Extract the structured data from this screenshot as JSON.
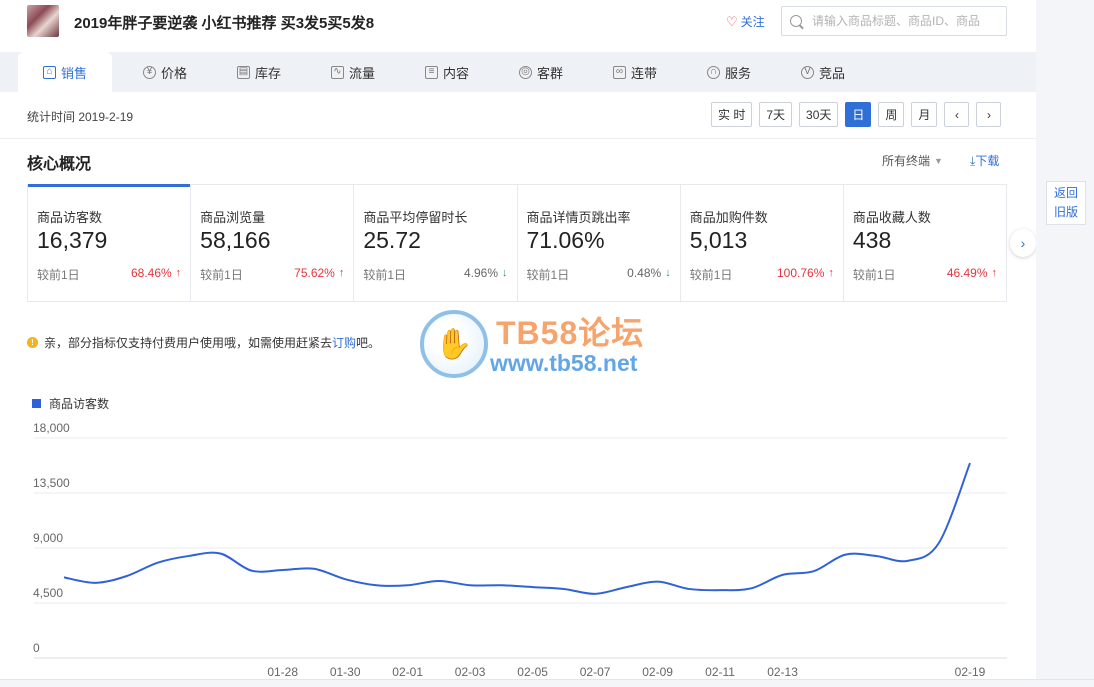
{
  "header": {
    "product_title": "2019年胖子要逆袭 小红书推荐 买3发5买5发8",
    "follow_label": "关注",
    "search_placeholder": "请输入商品标题、商品ID、商品"
  },
  "tabs": [
    {
      "label": "销售",
      "icon": "bag-icon",
      "active": true
    },
    {
      "label": "价格",
      "icon": "yen-icon"
    },
    {
      "label": "库存",
      "icon": "warehouse-icon"
    },
    {
      "label": "流量",
      "icon": "line-chart-icon"
    },
    {
      "label": "内容",
      "icon": "document-icon"
    },
    {
      "label": "客群",
      "icon": "people-icon"
    },
    {
      "label": "连带",
      "icon": "link-icon"
    },
    {
      "label": "服务",
      "icon": "headset-icon"
    },
    {
      "label": "竞品",
      "icon": "vs-icon"
    }
  ],
  "datebar": {
    "stat_time": "统计时间 2019-2-19",
    "ranges": [
      "实 时",
      "7天",
      "30天",
      "日",
      "周",
      "月"
    ],
    "active_range": "日",
    "prev": "‹",
    "next": "›"
  },
  "section": {
    "title": "核心概况",
    "terminal_label": "所有终端",
    "download_label": "下载"
  },
  "metrics": [
    {
      "name": "商品访客数",
      "value": "16,379",
      "compare": "较前1日",
      "pct": "68.46%",
      "dir": "up"
    },
    {
      "name": "商品浏览量",
      "value": "58,166",
      "compare": "较前1日",
      "pct": "75.62%",
      "dir": "up"
    },
    {
      "name": "商品平均停留时长",
      "value": "25.72",
      "compare": "较前1日",
      "pct": "4.96%",
      "dir": "down"
    },
    {
      "name": "商品详情页跳出率",
      "value": "71.06%",
      "compare": "较前1日",
      "pct": "0.48%",
      "dir": "down"
    },
    {
      "name": "商品加购件数",
      "value": "5,013",
      "compare": "较前1日",
      "pct": "100.76%",
      "dir": "up"
    },
    {
      "name": "商品收藏人数",
      "value": "438",
      "compare": "较前1日",
      "pct": "46.49%",
      "dir": "up"
    }
  ],
  "back_old": {
    "line1": "返回",
    "line2": "旧版"
  },
  "notice": {
    "text": "亲，部分指标仅支持付费用户使用哦，如需使用赶紧去",
    "link": "订购",
    "suffix": "吧。"
  },
  "watermark": {
    "title": "TB58论坛",
    "url": "www.tb58.net"
  },
  "colors": {
    "accent": "#2f6fd6",
    "line": "#2f62d6",
    "up": "#e5333d",
    "down": "#21a05a"
  },
  "chart_data": {
    "type": "line",
    "series": [
      {
        "name": "商品访客数",
        "values": [
          6600,
          6150,
          6700,
          7800,
          8350,
          8550,
          7150,
          7200,
          7300,
          6450,
          5950,
          5950,
          6300,
          5950,
          5950,
          5800,
          5650,
          5250,
          5800,
          6250,
          5650,
          5550,
          5700,
          6800,
          7100,
          8450,
          8350,
          7950,
          9400,
          15950
        ]
      }
    ],
    "x": [
      "01-21",
      "01-22",
      "01-23",
      "01-24",
      "01-25",
      "01-26",
      "01-27",
      "01-28",
      "01-29",
      "01-30",
      "01-31",
      "02-01",
      "02-02",
      "02-03",
      "02-04",
      "02-05",
      "02-06",
      "02-07",
      "02-08",
      "02-09",
      "02-10",
      "02-11",
      "02-12",
      "02-13",
      "02-14",
      "02-15",
      "02-16",
      "02-17",
      "02-18",
      "02-19"
    ],
    "x_tick_labels": [
      "01-28",
      "01-30",
      "02-01",
      "02-03",
      "02-05",
      "02-07",
      "02-09",
      "02-11",
      "02-13",
      "02-19"
    ],
    "y_ticks": [
      "18,000",
      "13,500",
      "9,000",
      "4,500",
      "0"
    ],
    "ylim": [
      0,
      18000
    ],
    "legend": "top-left",
    "grid": true
  }
}
